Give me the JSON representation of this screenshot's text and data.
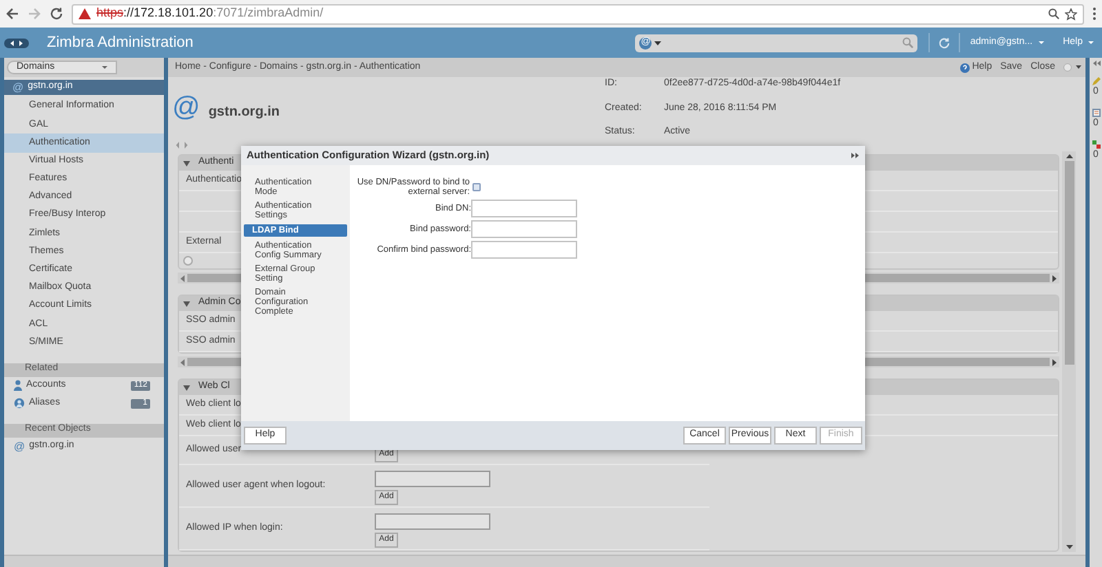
{
  "browser": {
    "url_scheme": "https",
    "url_host": "://172.18.101.20",
    "url_rest": ":7071/zimbraAdmin/"
  },
  "app_header": {
    "title": "Zimbra Administration",
    "search_scope": "@",
    "user": "admin@gstn...",
    "help": "Help"
  },
  "sidebar": {
    "dropdown": "Domains",
    "current": {
      "icon": "@",
      "label": "gstn.org.in"
    },
    "items": [
      {
        "label": "General Information",
        "selected": false
      },
      {
        "label": "GAL",
        "selected": false
      },
      {
        "label": "Authentication",
        "selected": true
      },
      {
        "label": "Virtual Hosts",
        "selected": false
      },
      {
        "label": "Features",
        "selected": false
      },
      {
        "label": "Advanced",
        "selected": false
      },
      {
        "label": "Free/Busy Interop",
        "selected": false
      },
      {
        "label": "Zimlets",
        "selected": false
      },
      {
        "label": "Themes",
        "selected": false
      },
      {
        "label": "Certificate",
        "selected": false
      },
      {
        "label": "Mailbox Quota",
        "selected": false
      },
      {
        "label": "Account Limits",
        "selected": false
      },
      {
        "label": "ACL",
        "selected": false
      },
      {
        "label": "S/MIME",
        "selected": false
      }
    ],
    "related": {
      "title": "Related",
      "items": [
        {
          "kind": "accounts",
          "label": "Accounts",
          "count": "112"
        },
        {
          "kind": "aliases",
          "label": "Aliases",
          "count": "1"
        }
      ]
    },
    "recent": {
      "title": "Recent Objects",
      "items": [
        {
          "icon": "@",
          "label": "gstn.org.in"
        }
      ]
    }
  },
  "toolbar": {
    "breadcrumb": "Home - Configure - Domains - gstn.org.in - Authentication",
    "actions": [
      "Help",
      "Save",
      "Close"
    ]
  },
  "domain": {
    "icon": "@",
    "name": "gstn.org.in",
    "fields": [
      {
        "label": "ID:",
        "value": "0f2ee877-d725-4d0d-a74e-98b49f044e1f"
      },
      {
        "label": "Created:",
        "value": "June 28, 2016 8:11:54 PM"
      },
      {
        "label": "Status:",
        "value": "Active"
      }
    ]
  },
  "sections": [
    {
      "title": "Authenti",
      "rows": [
        {
          "kind": "text",
          "label": "Authenticatio"
        },
        {
          "kind": "blank"
        },
        {
          "kind": "blank"
        },
        {
          "kind": "text",
          "label": "External"
        },
        {
          "kind": "toggle"
        }
      ]
    },
    {
      "title": "Admin Co",
      "rows": [
        {
          "kind": "text",
          "label": "SSO admin"
        },
        {
          "kind": "text",
          "label": "SSO admin"
        }
      ]
    },
    {
      "title": "Web Cl",
      "rows": [
        {
          "kind": "text",
          "label": "Web client lo"
        },
        {
          "kind": "text",
          "label": "Web client lo"
        },
        {
          "kind": "list",
          "label": "Allowed user",
          "button": "Add",
          "field": false
        },
        {
          "kind": "list",
          "label": "Allowed user agent when logout:",
          "button": "Add",
          "field": true
        },
        {
          "kind": "list",
          "label": "Allowed IP when login:",
          "button": "Add",
          "field": true
        }
      ]
    }
  ],
  "status_counts": [
    "0",
    "0",
    "0"
  ],
  "wizard": {
    "title": "Authentication Configuration Wizard (gstn.org.in)",
    "steps": [
      {
        "label": "Authentication Mode",
        "selected": false
      },
      {
        "label": "Authentication Settings",
        "selected": false
      },
      {
        "label": "LDAP Bind",
        "selected": true
      },
      {
        "label": "Authentication Config Summary",
        "selected": false
      },
      {
        "label": "External Group Setting",
        "selected": false
      },
      {
        "label": "Domain Configuration Complete",
        "selected": false
      }
    ],
    "checkbox": {
      "label": "Use DN/Password to bind to external server:",
      "checked": false
    },
    "fields": [
      {
        "label": "Bind DN:"
      },
      {
        "label": "Bind password:"
      },
      {
        "label": "Confirm bind password:"
      }
    ],
    "help_button": "Help",
    "buttons": [
      {
        "label": "Cancel",
        "disabled": false
      },
      {
        "label": "Previous",
        "disabled": false
      },
      {
        "label": "Next",
        "disabled": false
      },
      {
        "label": "Finish",
        "disabled": true
      }
    ]
  }
}
